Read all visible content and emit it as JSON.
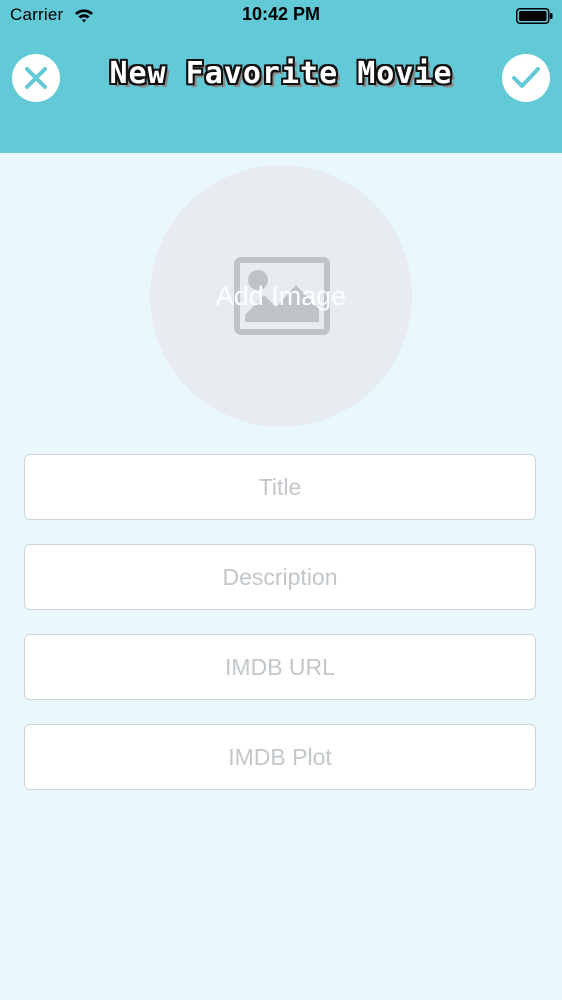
{
  "status_bar": {
    "carrier": "Carrier",
    "time": "10:42 PM",
    "wifi_icon": "wifi-icon",
    "battery_icon": "battery-icon"
  },
  "nav": {
    "title": "New Favorite Movie",
    "cancel_icon": "close-icon",
    "done_icon": "checkmark-icon"
  },
  "image_picker": {
    "label": "Add Image",
    "icon": "image-placeholder-icon"
  },
  "form": {
    "fields": [
      {
        "value": "",
        "placeholder": "Title"
      },
      {
        "value": "",
        "placeholder": "Description"
      },
      {
        "value": "",
        "placeholder": "IMDB URL"
      },
      {
        "value": "",
        "placeholder": "IMDB Plot"
      }
    ]
  },
  "colors": {
    "header_background": "#62C9D7",
    "page_background": "#EAF8FD",
    "accent": "#62C9D7",
    "field_border": "#CFD6DA",
    "placeholder_text": "#C2C7CB",
    "image_placeholder_bg": "#E6ECEF"
  }
}
